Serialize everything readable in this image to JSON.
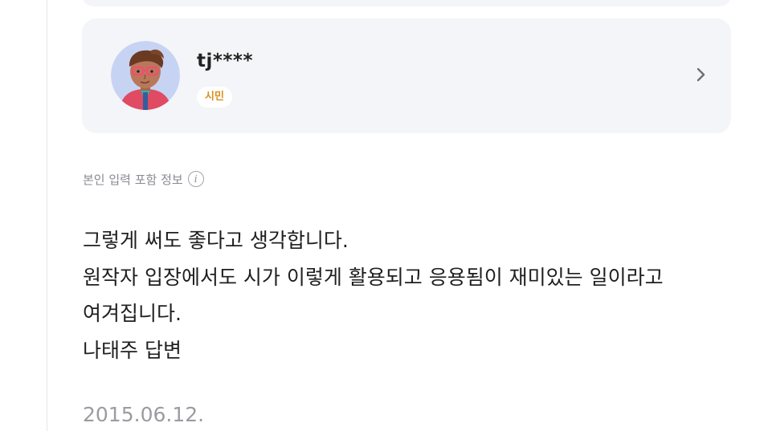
{
  "profile": {
    "username": "tj****",
    "grade": "시민",
    "avatar_icon": "cartoon-avatar-with-red-glasses-icon",
    "chevron_icon": "chevron-right-icon"
  },
  "info_row": {
    "label": "본인 입력 포함 정보",
    "icon": "info-icon",
    "icon_glyph": "i"
  },
  "answer": {
    "lines": [
      "그렇게 써도 좋다고 생각합니다.",
      "원작자 입장에서도 시가 이렇게 활용되고 응용됨이 재미있는 일이라고",
      "여겨집니다.",
      "나태주 답변"
    ],
    "date": "2015.06.12."
  },
  "colors": {
    "card_bg": "#f4f5f8",
    "badge_text": "#d88f1a",
    "body_text": "#1f1f21",
    "muted_text": "#888a90"
  }
}
